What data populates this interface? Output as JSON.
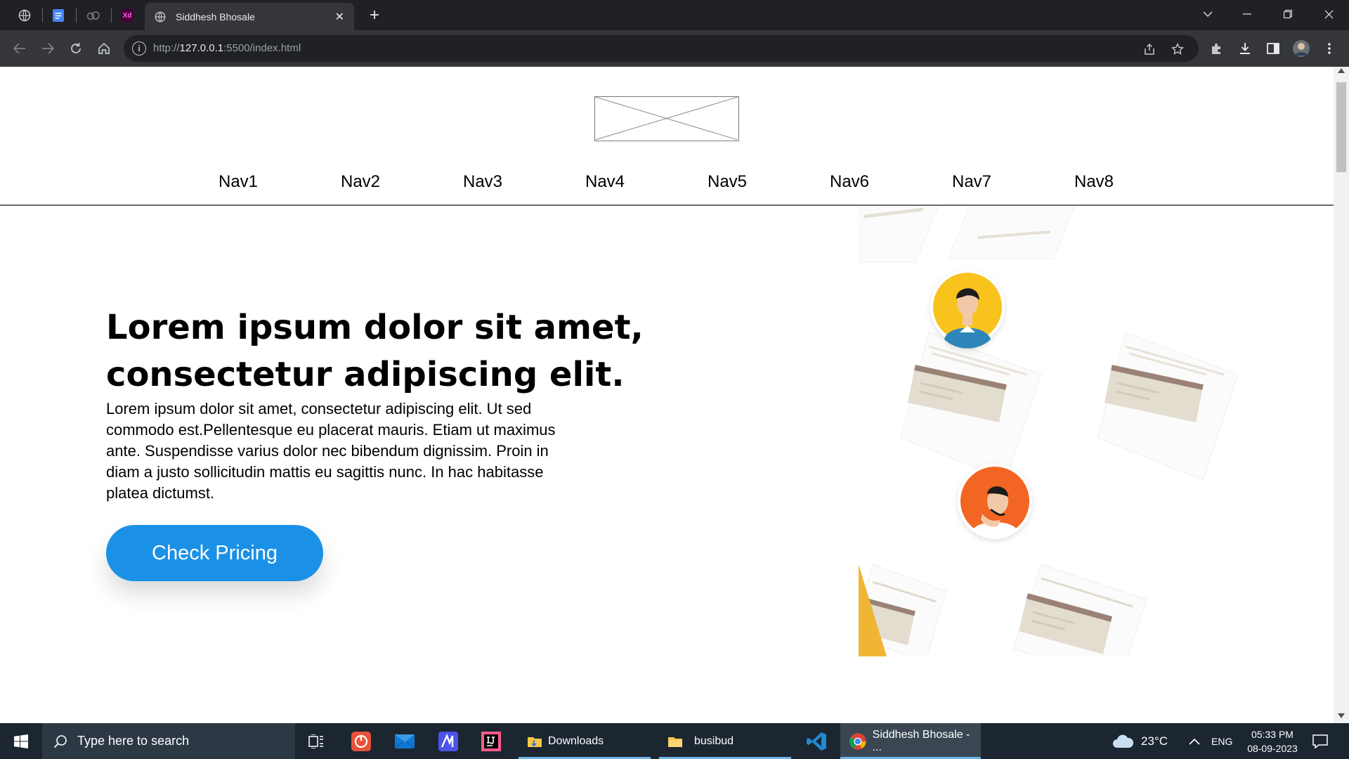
{
  "browser": {
    "tab_title": "Siddhesh Bhosale",
    "url_scheme": "http://",
    "url_host": "127.0.0.1",
    "url_rest": ":5500/index.html",
    "pinned_xd_label": "Xd",
    "close_glyph": "✕",
    "new_tab_glyph": "+",
    "info_glyph": "i"
  },
  "page": {
    "nav": [
      "Nav1",
      "Nav2",
      "Nav3",
      "Nav4",
      "Nav5",
      "Nav6",
      "Nav7",
      "Nav8"
    ],
    "hero_title": "Lorem ipsum dolor sit amet, consectetur adipiscing elit.",
    "hero_body": "Lorem ipsum dolor sit amet, consectetur adipiscing elit. Ut sed commodo est.Pellentesque eu placerat mauris. Etiam ut maximus ante. Suspendisse varius dolor nec bibendum dignissim. Proin in diam a justo sollicitudin mattis eu sagittis nunc. In hac habitasse platea dictumst.",
    "cta_label": "Check Pricing"
  },
  "taskbar": {
    "search_placeholder": "Type here to search",
    "apps": [
      {
        "label": "Downloads"
      },
      {
        "label": "busibud"
      },
      {
        "label": "Siddhesh Bhosale - ..."
      }
    ],
    "weather": "23°C",
    "lang": "ENG",
    "time": "05:33 PM",
    "date": "08-09-2023"
  },
  "colors": {
    "cta": "#1a91e6",
    "avatar_yellow": "#f7c31a",
    "avatar_orange": "#f26522"
  }
}
